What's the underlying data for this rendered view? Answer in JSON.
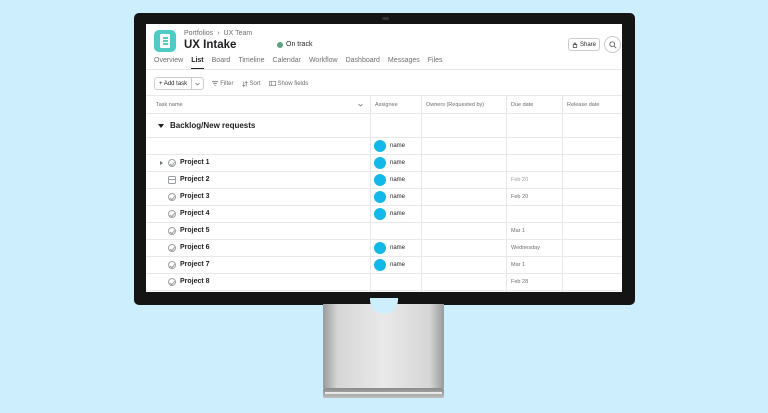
{
  "header": {
    "breadcrumb": [
      "Portfolios",
      "›",
      "UX Team"
    ],
    "title": "UX Intake",
    "status": "On track",
    "share_label": "Share"
  },
  "tabs": [
    "Overview",
    "List",
    "Board",
    "Timeline",
    "Calendar",
    "Workflow",
    "Dashboard",
    "Messages",
    "Files"
  ],
  "active_tab": "List",
  "toolbar": {
    "add_task": "+ Add task",
    "filter": "Filter",
    "sort": "Sort",
    "show_fields": "Show fields"
  },
  "columns": [
    "Task name",
    "Assignee",
    "Owners (Requested by)",
    "Due date",
    "Release date"
  ],
  "section": {
    "label": "Backlog/New requests"
  },
  "rows": [
    {
      "name": "",
      "assignee": "name",
      "due": "",
      "icon": "none",
      "expand": false,
      "avatar": true
    },
    {
      "name": "Project 1",
      "assignee": "name",
      "due": "",
      "icon": "check",
      "expand": true,
      "avatar": true
    },
    {
      "name": "Project 2",
      "assignee": "name",
      "due": "Feb 20",
      "icon": "calendar",
      "expand": false,
      "avatar": true,
      "due_muted": true
    },
    {
      "name": "Project 3",
      "assignee": "name",
      "due": "Feb 20",
      "icon": "check",
      "expand": false,
      "avatar": true
    },
    {
      "name": "Project 4",
      "assignee": "name",
      "due": "",
      "icon": "check",
      "expand": false,
      "avatar": true
    },
    {
      "name": "Project 5",
      "assignee": "",
      "due": "Mar 1",
      "icon": "check",
      "expand": false,
      "avatar": false
    },
    {
      "name": "Project 6",
      "assignee": "name",
      "due": "Wednesday",
      "icon": "check",
      "expand": false,
      "avatar": true
    },
    {
      "name": "Project 7",
      "assignee": "name",
      "due": "Mar 1",
      "icon": "check",
      "expand": false,
      "avatar": true
    },
    {
      "name": "Project 8",
      "assignee": "",
      "due": "Feb 28",
      "icon": "check",
      "expand": false,
      "avatar": false
    }
  ],
  "colors": {
    "accent_teal": "#4ecbc4",
    "avatar_blue": "#12b8e8",
    "status_green": "#5da283",
    "background": "#cdeffd"
  }
}
